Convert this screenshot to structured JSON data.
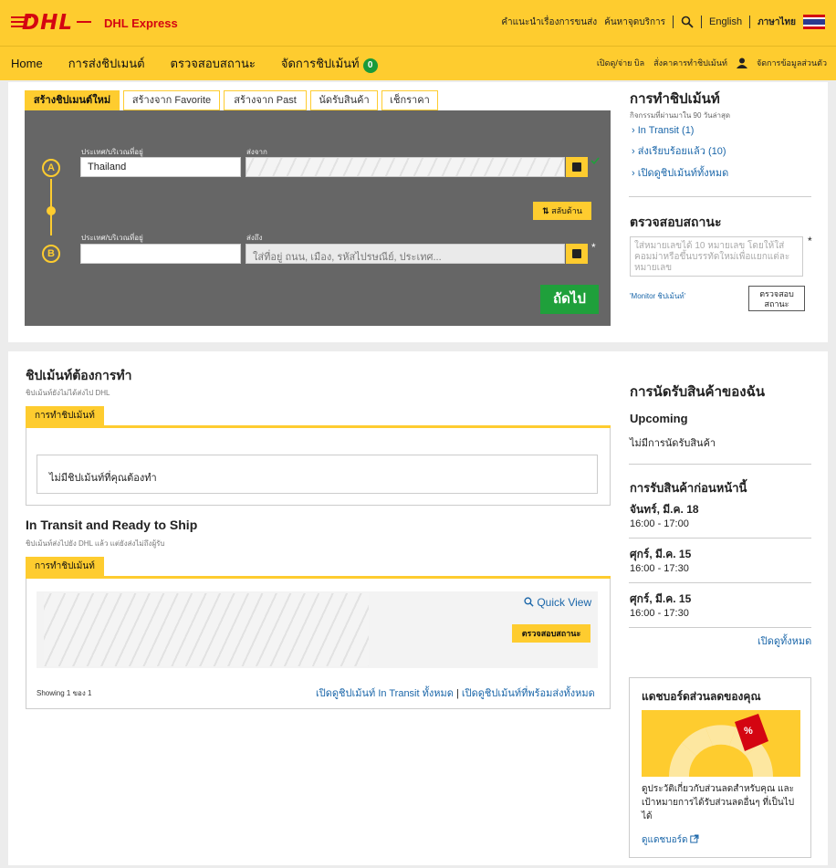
{
  "header": {
    "logo": "DHL",
    "product": "DHL Express",
    "links": [
      "คำแนะนำเรื่องการขนส่ง",
      "ค้นหาจุดบริการ"
    ],
    "lang_en": "English",
    "lang_th": "ภาษาไทย"
  },
  "nav": {
    "items": [
      "Home",
      "การส่งชิปเมนต์",
      "ตรวจสอบสถานะ",
      "จัดการชิปเม้นท์"
    ],
    "badge": "0",
    "right": [
      "เปิดดู/จ่าย บิล",
      "สั่งคาคารทำชิปเม้นท์",
      "จัดการข้อมูลส่วนตัว"
    ]
  },
  "create": {
    "tabs": [
      "สร้างชิปเมนต์ใหม่",
      "สร้างจาก Favorite",
      "สร้างจาก Past",
      "นัดรับสินค้า",
      "เช็กราคา"
    ],
    "from": {
      "letter": "A",
      "country_label": "ประเทศ/บริเวณที่อยู่",
      "country": "Thailand",
      "addr_label": "ส่งจาก"
    },
    "to": {
      "letter": "B",
      "country_label": "ประเทศ/บริเวณที่อยู่",
      "country": "",
      "addr_label": "ส่งถึง",
      "addr_placeholder": "ใส่ที่อยู่ ถนน, เมือง, รหัสไปรษณีย์, ประเทศ..."
    },
    "swap": "สลับด้าน",
    "next": "ถัดไป",
    "required": "*"
  },
  "activity": {
    "title": "การทำชิปเม้นท์",
    "sub": "กิจกรรมที่ผ่านมาใน 90 วันล่าสุด",
    "links": [
      "In Transit (1)",
      "ส่งเรียบร้อยแล้ว (10)",
      "เปิดดูชิปเม้นท์ทั้งหมด"
    ]
  },
  "track": {
    "title": "ตรวจสอบสถานะ",
    "placeholder": "ใส่หมายเลขได้ 10 หมายเลข โดยให้ใส่คอมม่าหรือขึ้นบรรทัดใหม่เพื่อแยกแต่ละหมายเลข",
    "monitor": "'Monitor ชิปเม้นท์'",
    "button": "ตรวจสอบ สถานะ",
    "required": "*"
  },
  "todo": {
    "title": "ชิปเม้นท์ต้องการทำ",
    "sub": "ชิปเม้นท์ยังไม่ได้ส่งไป DHL",
    "tab": "การทำชิปเม้นท์",
    "empty": "ไม่มีชิปเม้นท์ที่คุณต้องทำ"
  },
  "transit": {
    "title": "In Transit and Ready to Ship",
    "sub": "ชิปเม้นท์ส่งไปยัง DHL แล้ว แต่ยังส่งไม่ถึงผู้รับ",
    "tab": "การทำชิปเม้นท์",
    "quick_view": "Quick View",
    "status_btn": "ตรวจสอบสถานะ",
    "showing": "Showing 1 ของ 1",
    "link1": "เปิดดูชิปเม้นท์ In Transit ทั้งหมด",
    "link_sep": "|",
    "link2": "เปิดดูชิปเม้นท์ที่พร้อมส่งทั้งหมด"
  },
  "pickups": {
    "title": "การนัดรับสินค้าของฉัน",
    "upcoming": "Upcoming",
    "upcoming_empty": "ไม่มีการนัดรับสินค้า",
    "previous": "การรับสินค้าก่อนหน้านี้",
    "items": [
      {
        "date": "จันทร์, มี.ค. 18",
        "time": "16:00 - 17:00"
      },
      {
        "date": "ศุกร์, มี.ค. 15",
        "time": "16:00 - 17:30"
      },
      {
        "date": "ศุกร์, มี.ค. 15",
        "time": "16:00 - 17:30"
      }
    ],
    "view_all": "เปิดดูทั้งหมด"
  },
  "discount": {
    "title": "แดชบอร์ดส่วนลดของคุณ",
    "percent": "%",
    "text": "ดูประวัติเกี่ยวกับส่วนลดสำหรับคุณ และเป้าหมายการได้รับส่วนลดอื่นๆ ที่เป็นไปได้",
    "link": "ดูแดชบอร์ด"
  },
  "colors": {
    "brand_yellow": "#fecc2f",
    "brand_red": "#d40511",
    "go_green": "#1fa03b",
    "link_blue": "#1a66a9"
  }
}
